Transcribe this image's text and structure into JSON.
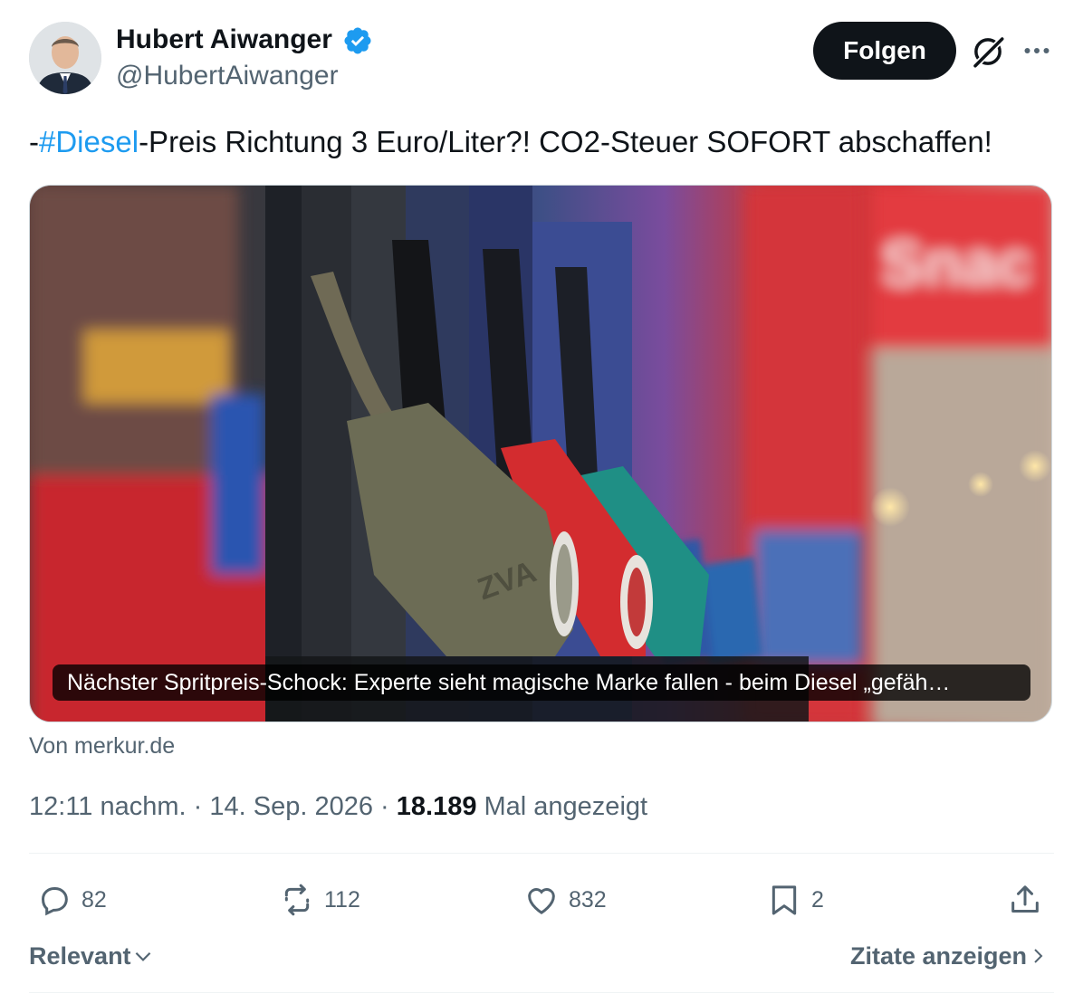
{
  "author": {
    "name": "Hubert Aiwanger",
    "handle": "@HubertAiwanger",
    "verified": true
  },
  "header": {
    "follow_label": "Folgen",
    "grok_icon": "grok-icon",
    "more_icon": "more-icon"
  },
  "tweet": {
    "prefix": "-",
    "hashtag": "#Diesel",
    "text": "-Preis Richtung 3 Euro/Liter?! CO2-Steuer SOFORT abschaffen!"
  },
  "card": {
    "caption": "Nächster Spritpreis-Schock: Experte sieht magische Marke fallen - beim Diesel „gefäh…",
    "source": "Von merkur.de",
    "nozzle_text": "ZVA"
  },
  "meta": {
    "time": "12:11 nachm.",
    "sep1": " · ",
    "date": "14. Sep. 2026",
    "sep2": " · ",
    "views": "18.189",
    "views_label": " Mal angezeigt"
  },
  "actions": {
    "replies": "82",
    "reposts": "112",
    "likes": "832",
    "bookmarks": "2"
  },
  "footer": {
    "sort_label": "Relevant",
    "quotes_label": "Zitate anzeigen"
  },
  "colors": {
    "accent": "#1d9bf0",
    "text": "#0f1419",
    "secondary": "#536471"
  }
}
